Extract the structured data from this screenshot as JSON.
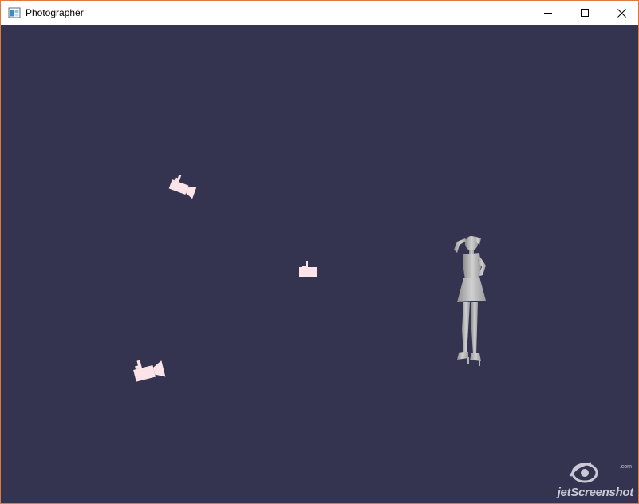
{
  "window": {
    "title": "Photographer",
    "controls": {
      "minimize_icon": "minimize-icon",
      "maximize_icon": "maximize-icon",
      "close_icon": "close-icon"
    }
  },
  "scene": {
    "background_color": "#343450",
    "camera_color": "#fbe4e8",
    "figure_color": "#c4c4c4",
    "objects": [
      "camera",
      "camera",
      "camera",
      "female-figure"
    ]
  },
  "watermark": {
    "brand": "jetScreenshot",
    "suffix": ".com"
  }
}
